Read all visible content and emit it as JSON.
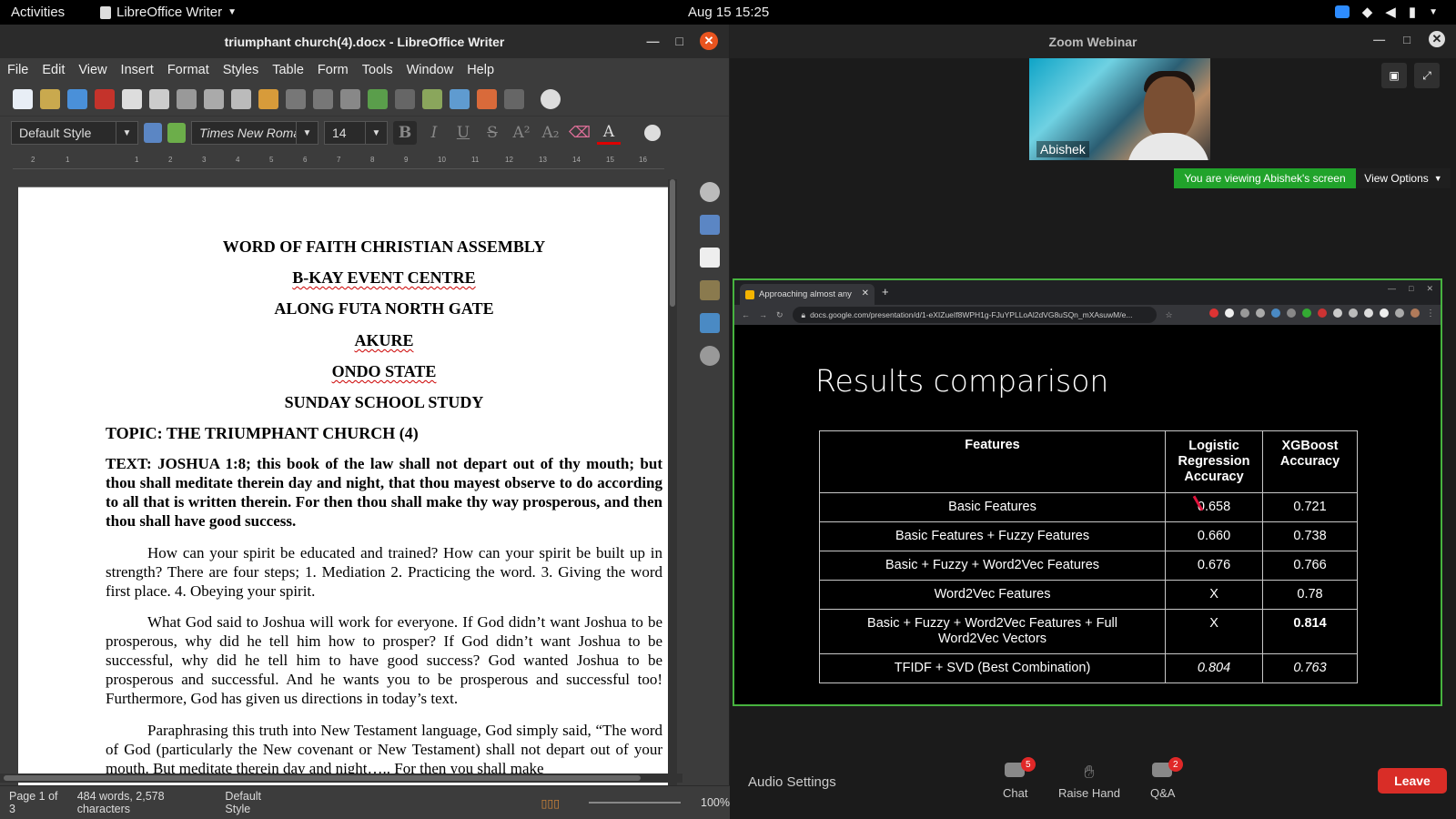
{
  "topbar": {
    "activities": "Activities",
    "app_name": "LibreOffice Writer",
    "clock": "Aug 15  15:25"
  },
  "writer": {
    "title": "triumphant church(4).docx - LibreOffice Writer",
    "menu": [
      "File",
      "Edit",
      "View",
      "Insert",
      "Format",
      "Styles",
      "Table",
      "Form",
      "Tools",
      "Window",
      "Help"
    ],
    "para_style": "Default Style",
    "font_name": "Times New Roman",
    "font_size": "14",
    "ruler": [
      "2",
      "1",
      "1",
      "2",
      "3",
      "4",
      "5",
      "6",
      "7",
      "8",
      "9",
      "10",
      "11",
      "12",
      "13",
      "14",
      "15",
      "16"
    ],
    "doc": {
      "h1": "WORD OF FAITH CHRISTIAN ASSEMBLY",
      "h2": "B-KAY EVENT CENTRE",
      "h3": "ALONG FUTA NORTH GATE",
      "h4": "AKURE",
      "h5": "ONDO STATE",
      "h6": "SUNDAY SCHOOL STUDY",
      "topic": "TOPIC: THE TRIUMPHANT CHURCH (4)",
      "text": "TEXT: JOSHUA 1:8; this book of the law shall not depart out of thy mouth; but thou shall meditate therein day and night, that thou mayest observe to do according to all that is written therein. For then thou shall make thy way prosperous, and then thou shall have good success.",
      "p1": "How can your spirit be educated and trained? How can your spirit be built up in strength? There are four steps; 1. Mediation 2. Practicing the word. 3. Giving the word first place. 4. Obeying your spirit.",
      "p2": "What God said to Joshua will work for everyone. If God didn’t want Joshua to be prosperous, why did he tell him how to prosper? If God didn’t want Joshua to be successful, why did he tell him to have good success? God wanted Joshua to be prosperous and successful. And he wants you to be prosperous and successful too! Furthermore, God has given us directions in today’s text.",
      "p3": "Paraphrasing this truth into New Testament language, God simply said, “The word of God (particularly the New covenant or New Testament) shall not depart out of your mouth. But meditate therein day and night….. For then you shall make"
    },
    "status": {
      "page": "Page 1 of 3",
      "words": "484 words, 2,578 characters",
      "style": "Default Style",
      "zoom": "100%"
    }
  },
  "zoom": {
    "title": "Zoom Webinar",
    "participant": "Abishek",
    "viewing": "You are viewing Abishek's screen",
    "view_options": "View Options",
    "browser_tab": "Approaching almost any",
    "url": "docs.google.com/presentation/d/1-eXIZueIf8WPH1g-FJuYPLLoAl2dVG8uSQn_mXAsuwM/e...",
    "slide_title": "Results comparison",
    "table": {
      "headers": [
        "Features",
        "Logistic Regression Accuracy",
        "XGBoost Accuracy"
      ],
      "rows": [
        [
          "Basic Features",
          "0.658",
          "0.721"
        ],
        [
          "Basic Features + Fuzzy Features",
          "0.660",
          "0.738"
        ],
        [
          "Basic + Fuzzy + Word2Vec Features",
          "0.676",
          "0.766"
        ],
        [
          "Word2Vec Features",
          "X",
          "0.78"
        ],
        [
          "Basic + Fuzzy + Word2Vec Features + Full Word2Vec Vectors",
          "X",
          "0.814"
        ],
        [
          "TFIDF + SVD (Best Combination)",
          "0.804",
          "0.763"
        ]
      ]
    },
    "bottom": {
      "audio": "Audio Settings",
      "chat": "Chat",
      "chat_badge": "5",
      "raise": "Raise Hand",
      "qa": "Q&A",
      "qa_badge": "2",
      "leave": "Leave"
    }
  }
}
